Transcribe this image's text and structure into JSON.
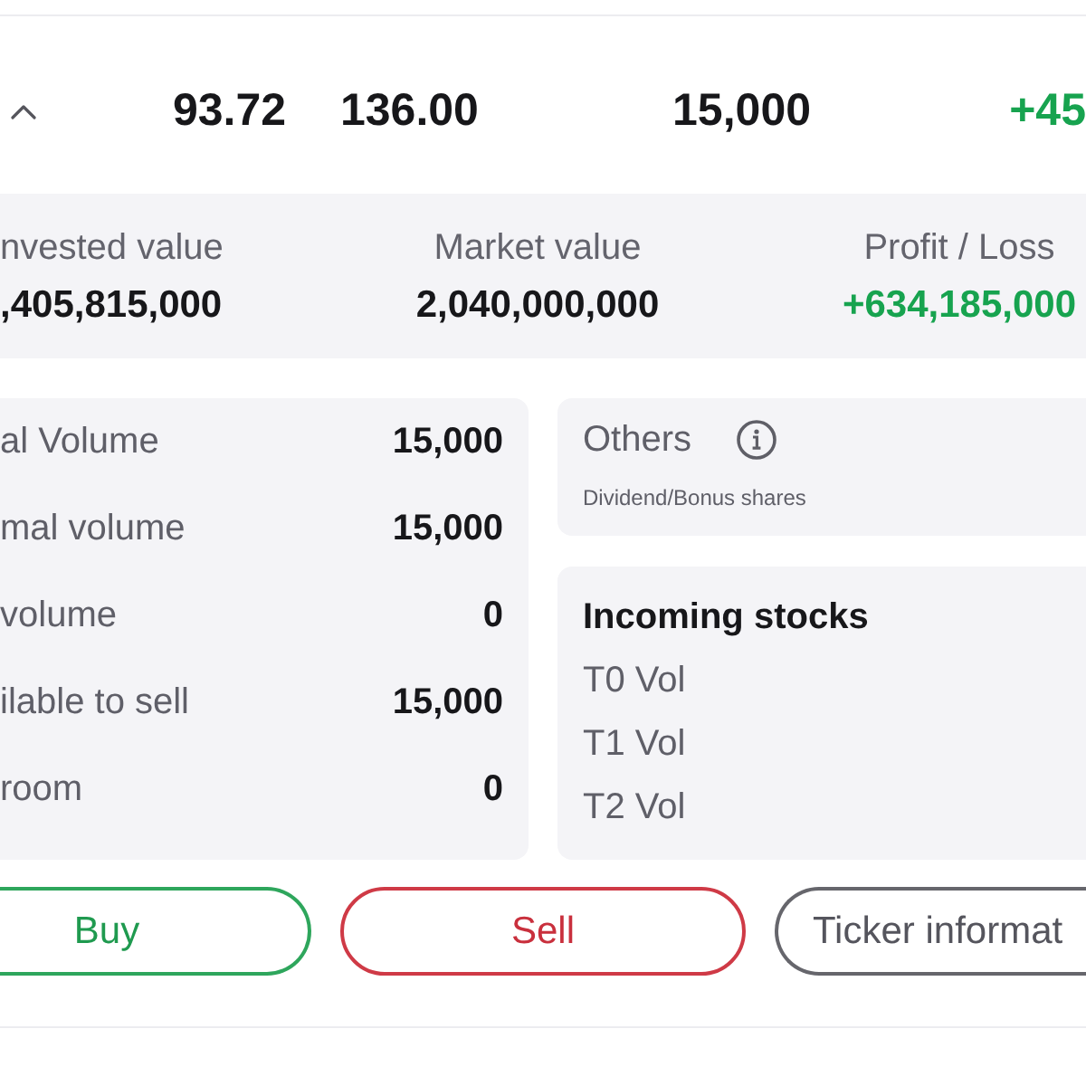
{
  "position_row": {
    "expanded": true,
    "cells": [
      {
        "text": "93.72",
        "kind": "number"
      },
      {
        "text": "136.00",
        "kind": "number"
      },
      {
        "text": "15,000",
        "kind": "number"
      },
      {
        "text": "+45",
        "kind": "gain"
      }
    ]
  },
  "summary": [
    {
      "label": "nvested value",
      "value": ",405,815,000",
      "kind": "plain"
    },
    {
      "label": "Market value",
      "value": "2,040,000,000",
      "kind": "plain"
    },
    {
      "label": "Profit / Loss",
      "value": "+634,185,000",
      "kind": "gain"
    }
  ],
  "volumes": [
    {
      "label": "al Volume",
      "value": "15,000"
    },
    {
      "label": "mal volume",
      "value": "15,000"
    },
    {
      "label": "volume",
      "value": "0"
    },
    {
      "label": "ilable to sell",
      "value": "15,000"
    },
    {
      "label": "room",
      "value": "0"
    }
  ],
  "others": {
    "title": "Others",
    "note": "Dividend/Bonus shares"
  },
  "incoming": {
    "title": "Incoming stocks",
    "items": [
      "T0 Vol",
      "T1 Vol",
      "T2 Vol"
    ]
  },
  "buttons": [
    {
      "label": "Buy",
      "kind": "buy"
    },
    {
      "label": "Sell",
      "kind": "sell"
    },
    {
      "label": "Ticker informat",
      "kind": "info"
    }
  ]
}
